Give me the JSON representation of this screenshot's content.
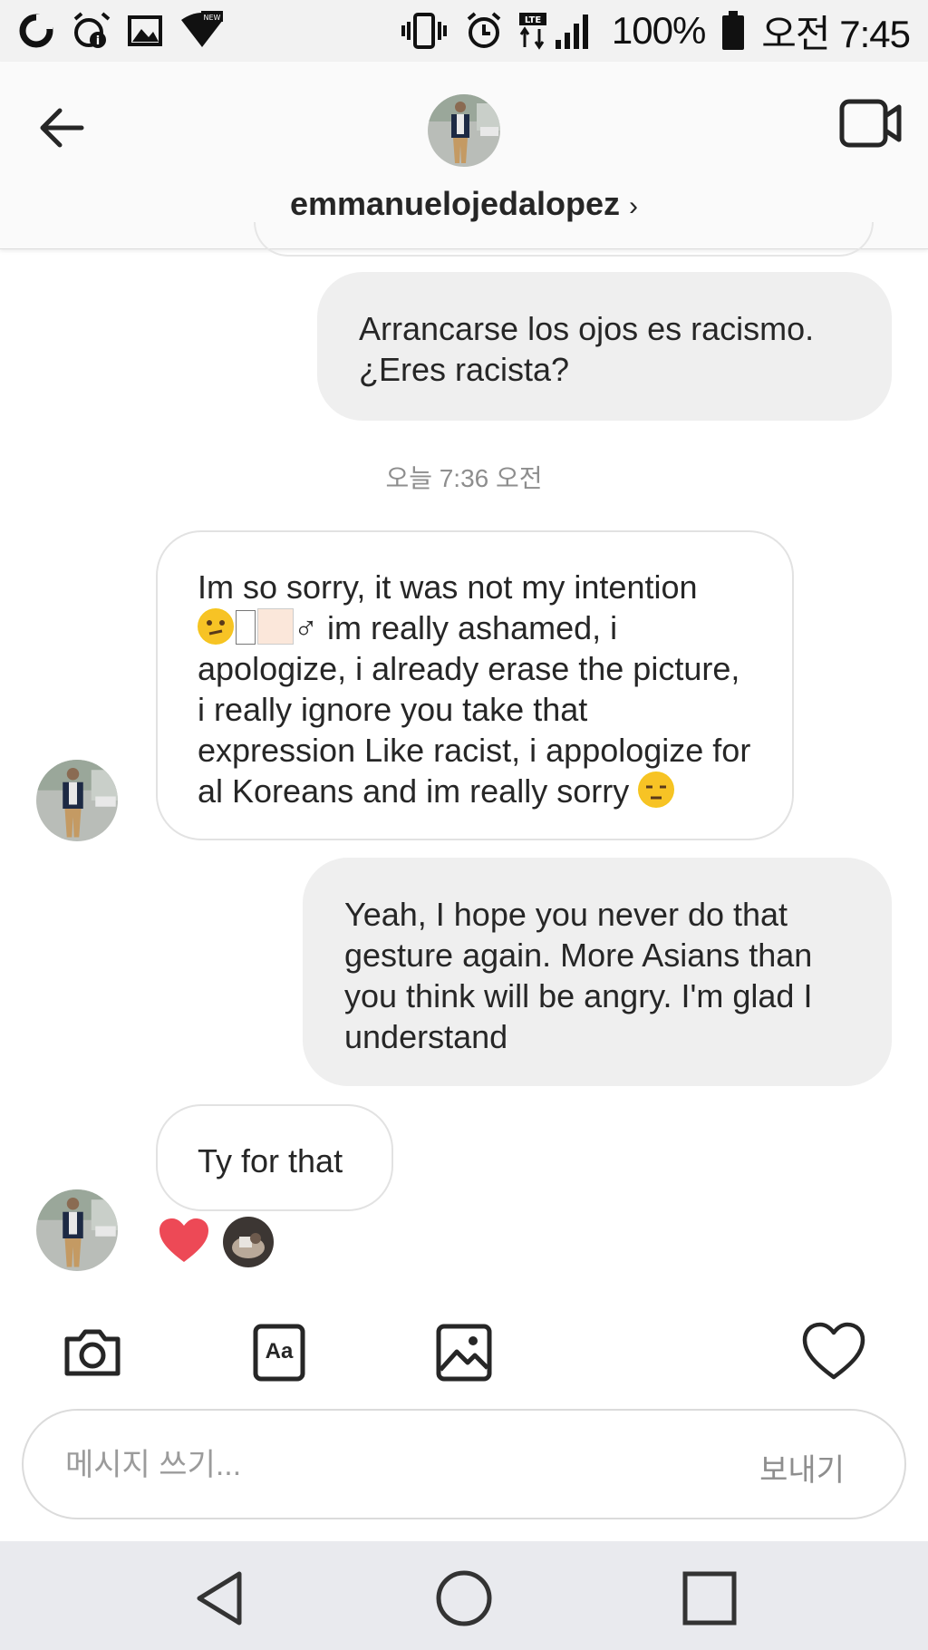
{
  "status_bar": {
    "battery": "100%",
    "time": "오전 7:45",
    "lte": "LTE",
    "new_badge": "NEW"
  },
  "header": {
    "username": "emmanuelojedalopez",
    "chevron": "›"
  },
  "messages": [
    {
      "from": "me",
      "text": "Arrancarse los ojos es racismo. ¿Eres racista?"
    },
    {
      "from": "them",
      "text_line1": "Im so sorry, it was not my intention",
      "text_line2_suffix": "♂ im really ashamed, i",
      "text_rest": "apologize, i already erase the picture,  i really ignore you take that expression Like racist, i appologize for al Koreans and im really sorry"
    },
    {
      "from": "me",
      "text": "Yeah, I hope you never do that gesture again. More Asians than you think will be angry. I'm glad I understand"
    },
    {
      "from": "them",
      "text": "Ty for that"
    }
  ],
  "timestamp": "오늘 7:36 오전",
  "toolbar": {
    "text_button_label": "Aa"
  },
  "composer": {
    "placeholder": "메시지 쓰기...",
    "send_label": "보내기"
  },
  "icons": {
    "camera": "camera-icon",
    "text": "text-format-icon",
    "gallery": "gallery-icon",
    "heart": "heart-icon",
    "back": "arrow-left-icon",
    "video": "video-call-icon"
  },
  "colors": {
    "reaction_heart": "#ed4956",
    "my_bubble": "#efefef",
    "nav_bar": "#e9eaee"
  }
}
